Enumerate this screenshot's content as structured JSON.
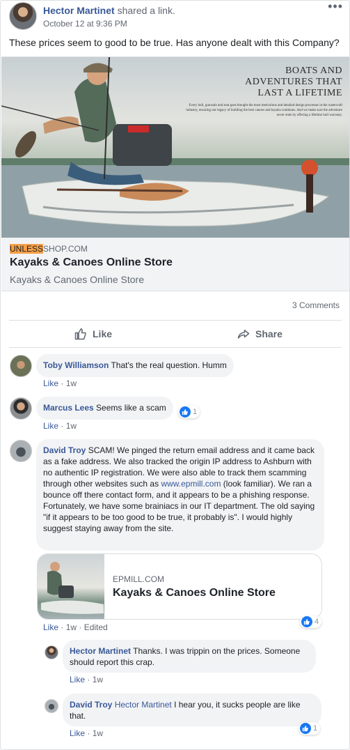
{
  "post": {
    "author": "Hector Martinet",
    "action": "shared a link.",
    "timestamp": "October 12 at 9:36 PM",
    "more_icon": "more-options-icon",
    "text": "These prices seem to good to be true. Has anyone dealt with this Company?"
  },
  "link_preview": {
    "image_headline": [
      "BOATS AND",
      "ADVENTURES THAT",
      "LAST A LIFETIME"
    ],
    "image_body": "Every hull, gunwale and seat goes thought the most meticulous and detailed design processes in the watercraft industry, ensuring our legacy of building the best canoes and kayaks continues. And we make sure the adventure never ends by offering a lifetime hull warranty.",
    "domain_highlight": "UNLESS",
    "domain_rest": "SHOP.COM",
    "title": "Kayaks & Canoes Online Store",
    "description": "Kayaks & Canoes Online Store",
    "highlight_color": "#f5a04a"
  },
  "stats": {
    "comments_count": "3 Comments"
  },
  "actions": {
    "like_label": "Like",
    "share_label": "Share"
  },
  "comments": [
    {
      "name": "Toby Williamson",
      "text": "That's the real question. Humm",
      "like": "Like",
      "time": "1w"
    },
    {
      "name": "Marcus Lees",
      "text": "Seems like a scam",
      "like": "Like",
      "time": "1w",
      "reactions": "1"
    },
    {
      "name": "David Troy",
      "text_before": "SCAM! We pinged the return email address and it came back as a fake address. We also tracked the origin IP address to Ashburn with no authentic IP registration. We were also able to track them scamming through other websites such as ",
      "link": "www.epmill.com",
      "text_after": " (look familiar). We ran a bounce off there contact form, and it appears to be a phishing response. Fortunately, we have some brainiacs in our IT department. The old saying \"if it appears to be too good to be true, it probably is\". I would highly suggest staying away from the site.",
      "card_domain": "EPMILL.COM",
      "card_title": "Kayaks & Canoes Online Store",
      "like": "Like",
      "time": "1w",
      "edited": "Edited",
      "reactions": "4"
    }
  ],
  "replies": [
    {
      "name": "Hector Martinet",
      "text": "Thanks. I was trippin on the prices. Someone should report this crap.",
      "like": "Like",
      "time": "1w"
    },
    {
      "name": "David Troy",
      "mention": "Hector Martinet",
      "text": "I hear you, it sucks people are like that.",
      "like": "Like",
      "time": "1w",
      "reactions": "1"
    }
  ],
  "colors": {
    "name_blue": "#385898",
    "meta_gray": "#606770",
    "bubble_bg": "#f2f3f5",
    "like_blue": "#1877f2"
  }
}
